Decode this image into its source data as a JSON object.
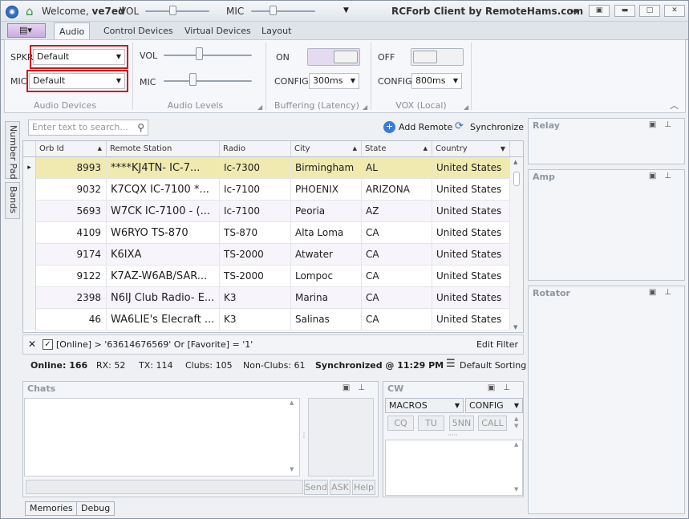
{
  "titlebar": {
    "welcome": "Welcome,",
    "user": "ve7ed",
    "vol_label": "VOL",
    "mic_label": "MIC",
    "vol_level": 0.42,
    "mic_level": 0.34,
    "app_title": "RCForb Client by RemoteHams.com"
  },
  "tabs": [
    "Audio",
    "Control Devices",
    "Virtual Devices",
    "Layout"
  ],
  "ribbon": {
    "audio_devices": {
      "spkr_label": "SPKR",
      "spkr_value": "Default",
      "mic_label": "MIC",
      "mic_value": "Default",
      "group": "Audio Devices"
    },
    "audio_levels": {
      "vol_label": "VOL",
      "mic_label": "MIC",
      "vol_level": 0.4,
      "mic_level": 0.33,
      "group": "Audio Levels"
    },
    "buffering": {
      "state": "ON",
      "config_label": "CONFIG",
      "config_value": "300ms",
      "group": "Buffering (Latency)"
    },
    "vox": {
      "state": "OFF",
      "config_label": "CONFIG",
      "config_value": "800ms",
      "group": "VOX (Local)"
    }
  },
  "side_tabs": [
    "Number Pad",
    "Bands"
  ],
  "search": {
    "placeholder": "Enter text to search..."
  },
  "actions": {
    "add_remote": "Add Remote",
    "synchronize": "Synchronize"
  },
  "grid": {
    "columns": [
      "Orb Id",
      "Remote Station",
      "Radio",
      "City",
      "State",
      "Country"
    ],
    "rows": [
      [
        "8993",
        "****KJ4TN- IC-7...",
        "Ic-7300",
        "Birmingham",
        "AL",
        "United States"
      ],
      [
        "9032",
        "K7CQX IC-7100 *...",
        "Ic-7100",
        "PHOENIX",
        "ARIZONA",
        "United States"
      ],
      [
        "5693",
        "W7CK IC-7100 - (...",
        "Ic-7100",
        "Peoria",
        "AZ",
        "United States"
      ],
      [
        "4109",
        "W6RYO TS-870",
        "TS-870",
        "Alta Loma",
        "CA",
        "United States"
      ],
      [
        "9174",
        "K6IXA",
        "TS-2000",
        "Atwater",
        "CA",
        "United States"
      ],
      [
        "9122",
        "K7AZ-W6AB/SAR...",
        "TS-2000",
        "Lompoc",
        "CA",
        "United States"
      ],
      [
        "2398",
        "N6IJ Club Radio- E...",
        "K3",
        "Marina",
        "CA",
        "United States"
      ],
      [
        "46",
        "WA6LIE's Elecraft ...",
        "K3",
        "Salinas",
        "CA",
        "United States"
      ]
    ]
  },
  "filter": {
    "text": "[Online] > '63614676569' Or [Favorite] = '1'",
    "edit": "Edit Filter"
  },
  "status": {
    "online": "Online: 166",
    "rx": "RX: 52",
    "tx": "TX: 114",
    "clubs": "Clubs: 105",
    "nonclubs": "Non-Clubs: 61",
    "sync": "Synchronized @ 11:29 PM",
    "sorting": "Default Sorting"
  },
  "panels": {
    "relay": "Relay",
    "amp": "Amp",
    "rotator": "Rotator",
    "chats": "Chats",
    "cw": "CW"
  },
  "chat_buttons": [
    "Send",
    "ASK",
    "Help"
  ],
  "cw": {
    "macros": "MACROS",
    "config": "CONFIG",
    "buttons": [
      "CQ",
      "TU",
      "5NN",
      "CALL"
    ]
  },
  "bottom_tabs": [
    "Memories",
    "Debug"
  ]
}
